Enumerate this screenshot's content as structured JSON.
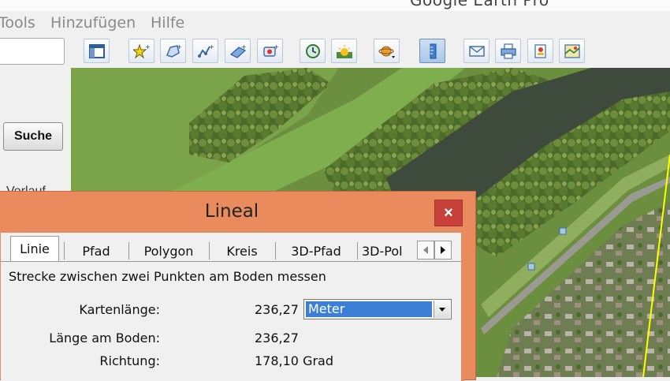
{
  "app_title": "Google Earth Pro",
  "menu": [
    "Tools",
    "Hinzufügen",
    "Hilfe"
  ],
  "toolbar": {
    "buttons": [
      "sidebar-toggle-icon",
      "placemark-icon",
      "polygon-icon",
      "path-icon",
      "image-overlay-icon",
      "record-tour-icon",
      "historical-imagery-icon",
      "sunlight-icon",
      "planets-icon",
      "ruler-icon",
      "email-icon",
      "print-icon",
      "save-image-icon",
      "view-in-maps-icon"
    ]
  },
  "left_panel": {
    "search_button": "Suche",
    "partial_label": "Verlauf"
  },
  "ruler_dialog": {
    "title": "Lineal",
    "close_symbol": "×",
    "tabs": [
      "Linie",
      "Pfad",
      "Polygon",
      "Kreis",
      "3D-Pfad",
      "3D-Pol"
    ],
    "active_tab": "Linie",
    "description": "Strecke zwischen zwei Punkten am Boden messen",
    "map_length_label": "Kartenlänge:",
    "map_length_value": "236,27",
    "unit_selected": "Meter",
    "ground_length_label": "Länge am Boden:",
    "ground_length_value": "236,27",
    "heading_label": "Richtung:",
    "heading_value": "178,10 Grad"
  },
  "colors": {
    "dialog_frame": "#e98b5c",
    "close_button": "#c8403a",
    "selection": "#3d7fd6",
    "measure_line": "#ffff00"
  }
}
